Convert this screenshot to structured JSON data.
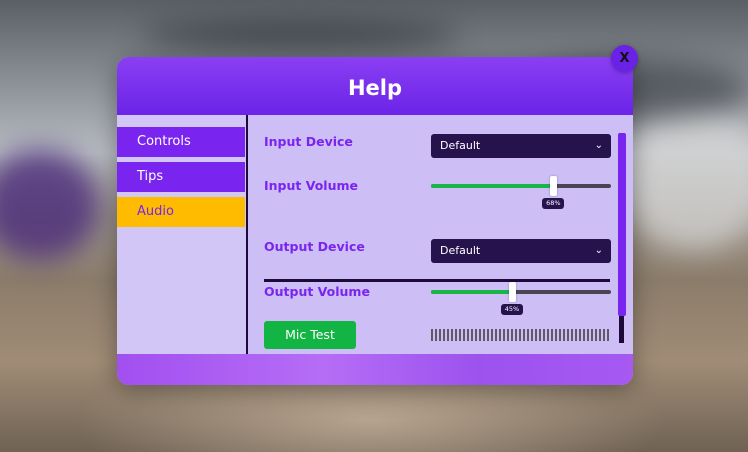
{
  "dialog": {
    "title": "Help",
    "close_label": "X"
  },
  "sidebar": {
    "items": [
      {
        "label": "Controls",
        "selected": false
      },
      {
        "label": "Tips",
        "selected": false
      },
      {
        "label": "Audio",
        "selected": true
      }
    ]
  },
  "audio": {
    "input_device_label": "Input Device",
    "input_device_value": "Default",
    "input_volume_label": "Input Volume",
    "input_volume_percent": 68,
    "input_volume_text": "68%",
    "output_device_label": "Output Device",
    "output_device_value": "Default",
    "output_volume_label": "Output Volume",
    "output_volume_percent": 45,
    "output_volume_text": "45%",
    "mic_test_label": "Mic Test",
    "mic_level_percent": 0
  },
  "scrollbar": {
    "position_percent": 0,
    "visible_fraction": 0.87
  },
  "colors": {
    "accent": "#7a24f0",
    "selected_tab": "#ffbb00",
    "slider_fill": "#18b548",
    "button_green": "#12b543",
    "panel": "#cdbef6",
    "dropdown_bg": "#26124d"
  },
  "icons": {
    "dropdown": "chevron-down-icon"
  }
}
